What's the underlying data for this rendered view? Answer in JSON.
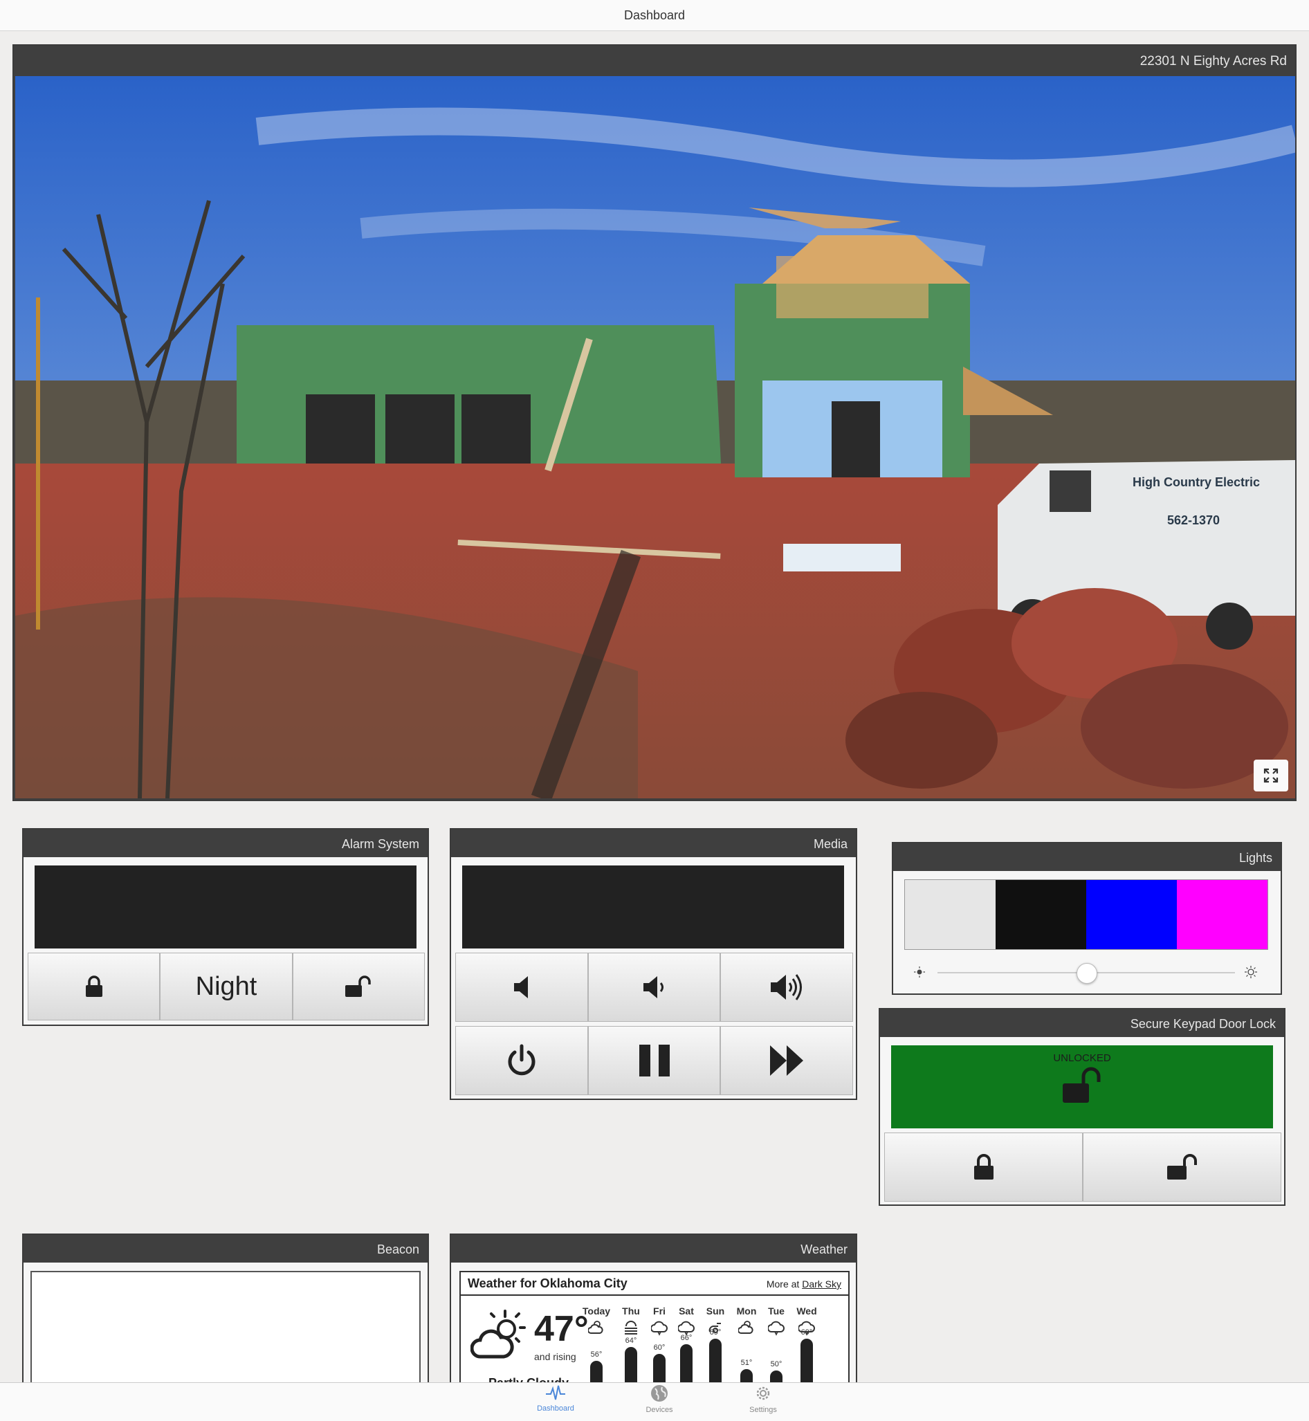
{
  "header": {
    "title": "Dashboard"
  },
  "camera": {
    "title": "22301 N Eighty Acres Rd",
    "expand_icon": "expand-icon",
    "van_text": "High Country Electric",
    "van_phone": "562-1370"
  },
  "alarm": {
    "title": "Alarm System",
    "buttons": {
      "arm_icon": "lock-icon",
      "night_label": "Night",
      "disarm_icon": "unlock-icon"
    }
  },
  "media": {
    "title": "Media",
    "buttons": [
      "volume-mute-icon",
      "volume-low-icon",
      "volume-high-icon",
      "power-icon",
      "pause-icon",
      "fast-forward-icon"
    ]
  },
  "lights": {
    "title": "Lights",
    "colors": [
      "#e6e6e6",
      "#101010",
      "#0000ff",
      "#ff00ff"
    ],
    "brightness": 0.5,
    "min_icon": "sun-small-icon",
    "max_icon": "sun-large-icon"
  },
  "door_lock": {
    "title": "Secure Keypad Door Lock",
    "status": "UNLOCKED",
    "status_color": "#0e7a1c",
    "buttons": [
      "lock-icon",
      "unlock-icon"
    ]
  },
  "beacon": {
    "title": "Beacon"
  },
  "weather": {
    "title": "Weather",
    "heading": "Weather for Oklahoma City",
    "more_prefix": "More at ",
    "more_link": "Dark Sky",
    "temp": "47°",
    "trend": "and rising",
    "summary": "Partly Cloudy",
    "days": [
      {
        "name": "Today",
        "icon": "partly-cloudy-icon",
        "hi": "56°",
        "hi_value": 56
      },
      {
        "name": "Thu",
        "icon": "fog-icon",
        "hi": "64°",
        "hi_value": 64
      },
      {
        "name": "Fri",
        "icon": "cloudy-icon",
        "hi": "60°",
        "hi_value": 60
      },
      {
        "name": "Sat",
        "icon": "cloudy-icon",
        "hi": "66°",
        "hi_value": 66
      },
      {
        "name": "Sun",
        "icon": "wind-icon",
        "hi": "69°",
        "hi_value": 69
      },
      {
        "name": "Mon",
        "icon": "partly-cloudy-icon",
        "hi": "51°",
        "hi_value": 51
      },
      {
        "name": "Tue",
        "icon": "cloudy-icon",
        "hi": "50°",
        "hi_value": 50
      },
      {
        "name": "Wed",
        "icon": "cloudy-icon",
        "hi": "69°",
        "hi_value": 69
      }
    ]
  },
  "nav": {
    "tabs": [
      {
        "label": "Dashboard",
        "icon": "pulse-icon",
        "active": true
      },
      {
        "label": "Devices",
        "icon": "globe-icon",
        "active": false
      },
      {
        "label": "Settings",
        "icon": "gear-icon",
        "active": false
      }
    ]
  }
}
